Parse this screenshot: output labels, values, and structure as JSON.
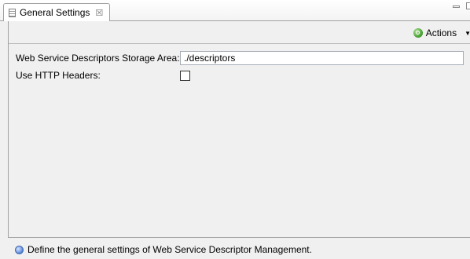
{
  "tab": {
    "title": "General Settings",
    "close_glyph": "☒",
    "icon": "document-icon"
  },
  "toolbar": {
    "actions_label": "Actions",
    "actions_icon": "actions-icon",
    "dropdown_glyph": "▼"
  },
  "form": {
    "storage_label": "Web Service Descriptors Storage Area:",
    "storage_value": "./descriptors",
    "http_headers_label": "Use HTTP Headers:",
    "http_headers_checked": false
  },
  "status": {
    "text": "Define the general settings of Web Service Descriptor Management.",
    "icon": "info-icon"
  },
  "colors": {
    "background": "#f0f0f0",
    "border": "#a0a0a0",
    "accent_green": "#3d9a2a",
    "info_blue": "#4f7fd8"
  }
}
